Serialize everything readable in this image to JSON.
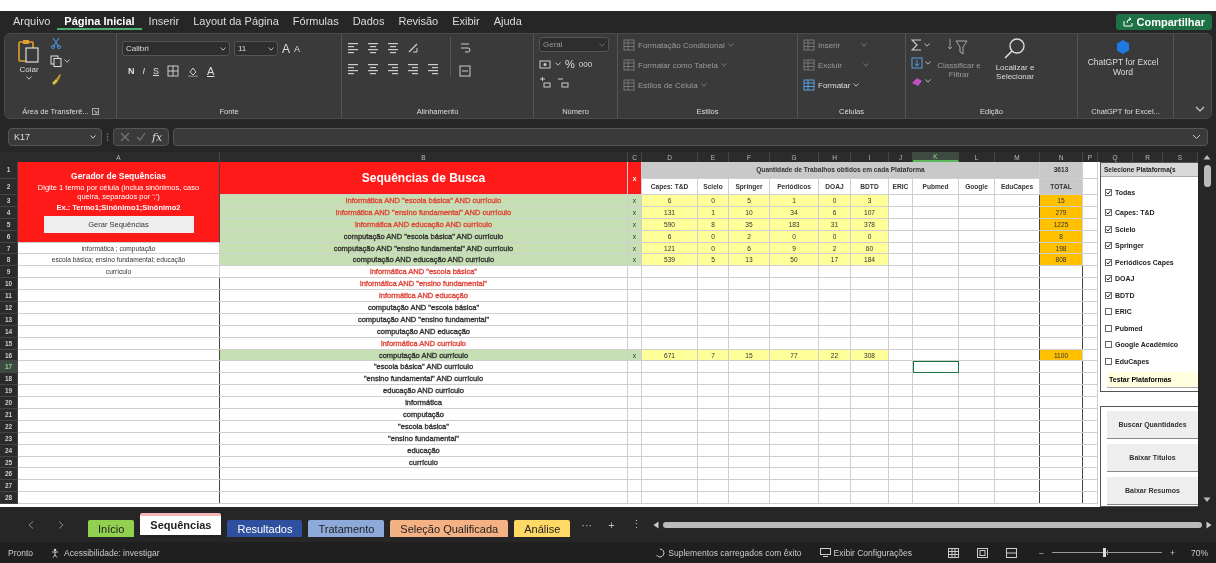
{
  "menu": [
    {
      "label": "Arquivo",
      "selected": false
    },
    {
      "label": "Página Inicial",
      "selected": true
    },
    {
      "label": "Inserir",
      "selected": false
    },
    {
      "label": "Layout da Página",
      "selected": false
    },
    {
      "label": "Fórmulas",
      "selected": false
    },
    {
      "label": "Dados",
      "selected": false
    },
    {
      "label": "Revisão",
      "selected": false
    },
    {
      "label": "Exibir",
      "selected": false
    },
    {
      "label": "Ajuda",
      "selected": false
    }
  ],
  "share_button": "Compartilhar",
  "ribbon": {
    "groups": [
      {
        "kind": "clipboard",
        "label": "Área de Transferê...",
        "paste": "Colar"
      },
      {
        "kind": "font",
        "label": "Fonte",
        "font_name": "Calibri",
        "font_size": "11",
        "grow": "A",
        "shrink": "A",
        "bold": "N",
        "italic": "I",
        "underline": "S",
        "font_color": "A"
      },
      {
        "kind": "alignment",
        "label": "Alinhamento"
      },
      {
        "kind": "number",
        "label": "Número",
        "format": {
          "label": "Geral",
          "disabled": true
        },
        "percent": "%",
        "thousands": "000"
      },
      {
        "kind": "list",
        "label": "Estilos",
        "items": [
          {
            "label": "Formatação Condicional",
            "disabled": true
          },
          {
            "label": "Formatar como Tabela",
            "disabled": true
          },
          {
            "label": "Estilos de Célula",
            "disabled": true
          }
        ]
      },
      {
        "kind": "list",
        "label": "Células",
        "items": [
          {
            "label": "Inserir",
            "disabled": true
          },
          {
            "label": "Excluir",
            "disabled": true
          },
          {
            "label": "Formatar",
            "disabled": false
          }
        ]
      },
      {
        "kind": "editing",
        "label": "Edição",
        "sort": {
          "label": "Classificar e Filtrar",
          "disabled": true
        },
        "find": "Localizar e Selecionar"
      },
      {
        "kind": "addin",
        "label": "ChatGPT for Excel...",
        "button": "ChatGPT for Excel Word"
      }
    ]
  },
  "formula_bar": {
    "name_box": "K17",
    "function_label": "fx"
  },
  "sheet": {
    "column_headers": [
      {
        "label": "A",
        "selected": false
      },
      {
        "label": "B",
        "selected": false
      },
      {
        "label": "C",
        "selected": false
      },
      {
        "label": "D",
        "selected": false
      },
      {
        "label": "E",
        "selected": false
      },
      {
        "label": "F",
        "selected": false
      },
      {
        "label": "G",
        "selected": false
      },
      {
        "label": "H",
        "selected": false
      },
      {
        "label": "I",
        "selected": false
      },
      {
        "label": "J",
        "selected": false
      },
      {
        "label": "K",
        "selected": true
      },
      {
        "label": "L",
        "selected": false
      },
      {
        "label": "M",
        "selected": false
      },
      {
        "label": "N",
        "selected": false
      },
      {
        "label": "P",
        "selected": false
      },
      {
        "label": "Q",
        "selected": false
      },
      {
        "label": "R",
        "selected": false
      },
      {
        "label": "S",
        "selected": false
      }
    ],
    "row_numbers": [
      {
        "label": "1",
        "selected": false
      },
      {
        "label": "2",
        "selected": false
      },
      {
        "label": "3",
        "selected": false
      },
      {
        "label": "4",
        "selected": false
      },
      {
        "label": "5",
        "selected": false
      },
      {
        "label": "6",
        "selected": false
      },
      {
        "label": "7",
        "selected": false
      },
      {
        "label": "8",
        "selected": false
      },
      {
        "label": "9",
        "selected": false
      },
      {
        "label": "10",
        "selected": false
      },
      {
        "label": "11",
        "selected": false
      },
      {
        "label": "12",
        "selected": false
      },
      {
        "label": "13",
        "selected": false
      },
      {
        "label": "14",
        "selected": false
      },
      {
        "label": "15",
        "selected": false
      },
      {
        "label": "16",
        "selected": false
      },
      {
        "label": "17",
        "selected": true
      },
      {
        "label": "18",
        "selected": false
      },
      {
        "label": "19",
        "selected": false
      },
      {
        "label": "20",
        "selected": false
      },
      {
        "label": "21",
        "selected": false
      },
      {
        "label": "22",
        "selected": false
      },
      {
        "label": "23",
        "selected": false
      },
      {
        "label": "24",
        "selected": false
      },
      {
        "label": "25",
        "selected": false
      },
      {
        "label": "26",
        "selected": false
      },
      {
        "label": "27",
        "selected": false
      },
      {
        "label": "28",
        "selected": false
      }
    ],
    "generator": {
      "title": "Gerador de Sequências",
      "instructions": "Digite 1 termo por célula (inclua sinônimos, caso queira, separados por ';')",
      "example": "Ex.: Termo1;Sinônimo1;Sinônimo2",
      "button": "Gerar Sequências"
    },
    "terms": [
      "informática ; computação",
      "escola básica; ensino fundamental; educação",
      "currículo"
    ],
    "sequences": {
      "title": "Sequências de Busca",
      "mark_header": "x",
      "rows": [
        {
          "text": "informática AND \"escola básica\" AND currículo",
          "color": "#e0453a",
          "highlighted": true,
          "mark": "x",
          "counts": [
            "6",
            "0",
            "5",
            "1",
            "0",
            "3"
          ],
          "total": "15"
        },
        {
          "text": "informática AND \"ensino fundamental\" AND currículo",
          "color": "#e0453a",
          "highlighted": true,
          "mark": "x",
          "counts": [
            "131",
            "1",
            "10",
            "34",
            "6",
            "107"
          ],
          "total": "279"
        },
        {
          "text": "informática AND educação AND currículo",
          "color": "#e0453a",
          "highlighted": true,
          "mark": "x",
          "counts": [
            "590",
            "8",
            "35",
            "183",
            "31",
            "378"
          ],
          "total": "1225"
        },
        {
          "text": "computação AND \"escola básica\" AND currículo",
          "color": "#333333",
          "highlighted": true,
          "mark": "x",
          "counts": [
            "6",
            "0",
            "2",
            "0",
            "0",
            "0"
          ],
          "total": "8"
        },
        {
          "text": "computação AND \"ensino fundamental\" AND currículo",
          "color": "#333333",
          "highlighted": true,
          "mark": "x",
          "counts": [
            "121",
            "0",
            "6",
            "9",
            "2",
            "60"
          ],
          "total": "198"
        },
        {
          "text": "computação AND educação AND currículo",
          "color": "#333333",
          "highlighted": true,
          "mark": "x",
          "counts": [
            "539",
            "5",
            "13",
            "50",
            "17",
            "184"
          ],
          "total": "808"
        },
        {
          "text": "informática AND \"escola básica\"",
          "color": "#e0453a",
          "highlighted": false
        },
        {
          "text": "informática AND \"ensino fundamental\"",
          "color": "#e0453a",
          "highlighted": false
        },
        {
          "text": "informática AND educação",
          "color": "#e0453a",
          "highlighted": false
        },
        {
          "text": "computação AND \"escola básica\"",
          "color": "#333333",
          "highlighted": false
        },
        {
          "text": "computação AND \"ensino fundamental\"",
          "color": "#333333",
          "highlighted": false
        },
        {
          "text": "computação AND educação",
          "color": "#333333",
          "highlighted": false
        },
        {
          "text": "informática AND currículo",
          "color": "#e0453a",
          "highlighted": false
        },
        {
          "text": "computação AND currículo",
          "color": "#333333",
          "highlighted": true,
          "mark": "x",
          "counts": [
            "671",
            "7",
            "15",
            "77",
            "22",
            "308"
          ],
          "total": "1100"
        },
        {
          "text": "\"escola básica\" AND currículo",
          "color": "#333333",
          "highlighted": false
        },
        {
          "text": "\"ensino fundamental\" AND currículo",
          "color": "#333333",
          "highlighted": false
        },
        {
          "text": "educação AND currículo",
          "color": "#333333",
          "highlighted": false
        },
        {
          "text": "informática",
          "color": "#333333",
          "highlighted": false
        },
        {
          "text": "computação",
          "color": "#333333",
          "highlighted": false
        },
        {
          "text": "\"escola básica\"",
          "color": "#333333",
          "highlighted": false
        },
        {
          "text": "\"ensino fundamental\"",
          "color": "#333333",
          "highlighted": false
        },
        {
          "text": "educação",
          "color": "#333333",
          "highlighted": false
        },
        {
          "text": "currículo",
          "color": "#333333",
          "highlighted": false
        }
      ]
    },
    "results": {
      "title": "Quantidade de Trabalhos obtidos em cada Plataforma",
      "grand_total": "3613",
      "total_label": "TOTAL",
      "platforms": [
        "Capes: T&D",
        "Scielo",
        "Springer",
        "Periódicos",
        "DOAJ",
        "BDTD",
        "ERIC",
        "Pubmed",
        "Google",
        "EduCapes"
      ]
    },
    "platform_panel": {
      "title": "Selecione Plataforma(s",
      "options": [
        {
          "label": "Todas",
          "checked": true
        },
        {
          "label": "Capes: T&D",
          "checked": true
        },
        {
          "label": "Scielo",
          "checked": true
        },
        {
          "label": "Springer",
          "checked": true
        },
        {
          "label": "Periódicos Capes",
          "checked": true
        },
        {
          "label": "DOAJ",
          "checked": true
        },
        {
          "label": "BDTD",
          "checked": true
        },
        {
          "label": "ERIC",
          "checked": false
        },
        {
          "label": "Pubmed",
          "checked": false
        },
        {
          "label": "Google Acadêmico",
          "checked": false
        },
        {
          "label": "EduCapes",
          "checked": false
        }
      ],
      "test_button": "Testar Plataformas",
      "actions": [
        "Buscar Quantidades",
        "Baixar Títulos",
        "Baixar Resumos"
      ]
    }
  },
  "sheet_tabs": [
    {
      "label": "Início",
      "color": "#92d050",
      "selected": false
    },
    {
      "label": "Sequências",
      "color": "#f4b6b6",
      "selected": true
    },
    {
      "label": "Resultados",
      "color": "#2f4f9f",
      "selected": false
    },
    {
      "label": "Tratamento",
      "color": "#8eaadb",
      "selected": false
    },
    {
      "label": "Seleção Qualificada",
      "color": "#f4b183",
      "selected": false
    },
    {
      "label": "Análise",
      "color": "#ffd966",
      "selected": false
    }
  ],
  "tab_controls": [
    "···",
    "+",
    "⋮"
  ],
  "status_bar": {
    "ready": "Pronto",
    "accessibility": "Acessibilidade: investigar",
    "addins": "Suplementos carregados com êxito",
    "display_settings": "Exibir Configurações",
    "zoom_out": "−",
    "zoom_in": "+",
    "zoom": {
      "level": 0.48
    },
    "zoom_label": "70%"
  }
}
